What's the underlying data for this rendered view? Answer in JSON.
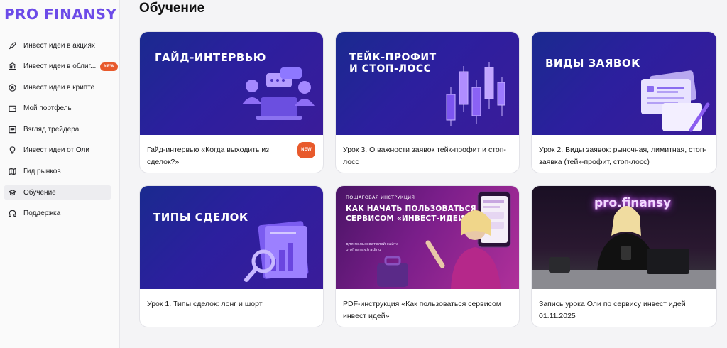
{
  "logo": "PRO FINANSY",
  "badge": "NEW",
  "sidebar": {
    "items": [
      {
        "label": "Инвест идеи в акциях",
        "icon": "rocket-icon"
      },
      {
        "label": "Инвест идеи в облиг...",
        "icon": "bank-icon",
        "badge": "NEW"
      },
      {
        "label": "Инвест идеи в крипте",
        "icon": "coin-icon"
      },
      {
        "label": "Мой портфель",
        "icon": "wallet-icon"
      },
      {
        "label": "Взгляд трейдера",
        "icon": "news-icon"
      },
      {
        "label": "Инвест идеи от Оли",
        "icon": "lightbulb-icon"
      },
      {
        "label": "Гид рынков",
        "icon": "map-icon"
      },
      {
        "label": "Обучение",
        "icon": "graduation-cap-icon",
        "active": true
      },
      {
        "label": "Поддержка",
        "icon": "headphones-icon"
      }
    ]
  },
  "main": {
    "title": "Обучение",
    "cards": [
      {
        "cover": "ГАЙД-ИНТЕРВЬЮ",
        "title": "Гайд-интервью «Когда выходить из сделок?»",
        "badge": "NEW"
      },
      {
        "cover_line1": "ТЕЙК-ПРОФИТ",
        "cover_line2": "И СТОП-ЛОСС",
        "title": "Урок 3. О важности заявок тейк-профит и стоп-лосс"
      },
      {
        "cover": "ВИДЫ ЗАЯВОК",
        "title": "Урок 2. Виды заявок: рыночная, лимитная, стоп-заявка (тейк-профит, стоп-лосс)"
      },
      {
        "cover": "ТИПЫ СДЕЛОК",
        "title": "Урок 1. Типы сделок: лонг и шорт"
      },
      {
        "cover_kicker": "ПОШАГОВАЯ ИНСТРУКЦИЯ",
        "cover_line1": "КАК НАЧАТЬ ПОЛЬЗОВАТЬСЯ",
        "cover_line2": "СЕРВИСОМ «ИНВЕСТ-ИДЕИ»",
        "cover_sub1": "для пользователей сайта",
        "cover_sub2": "profinansy.trading",
        "title": "PDF-инструкция «Как пользоваться сервисом инвест идей»"
      },
      {
        "cover": "pro.finansy",
        "title": "Запись урока Оли по сервису инвест идей 01.11.2025"
      }
    ]
  },
  "colors": {
    "accent": "#6c4be8",
    "badge": "#e85a2c"
  }
}
